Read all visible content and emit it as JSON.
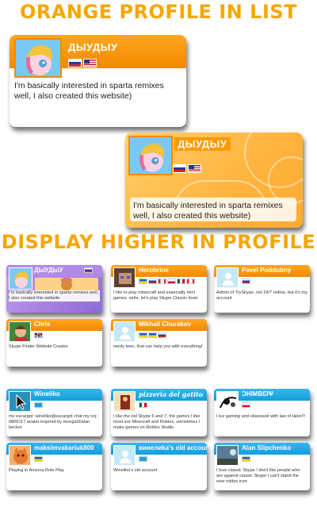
{
  "headings": {
    "top": "ORANGE PROFILE IN LIST",
    "middle": "DISPLAY HIGHER IN PROFILE"
  },
  "profile_card_list": {
    "name": "ДЫУДЫУ",
    "bio_line1": "I'm basically interested in sparta remixes",
    "bio_line2": "well, I also created this website)",
    "flags": [
      "ru",
      "us"
    ]
  },
  "profile_card_highlight": {
    "name": "ДЫУДЫУ",
    "bio_line1": "I'm basically interested in sparta remixes",
    "bio_line2": "well, I also created this website)",
    "flags": [
      "ru",
      "us"
    ]
  },
  "orange_cards": [
    {
      "name": "ДЫУДЫУ",
      "bio": "I'm basically interested in sparta remixes well, I also created this website"
    },
    {
      "name": "Herobrine",
      "bio": "I like to play minecraft and especially mini games. write, let's play Skype Classic lover"
    },
    {
      "name": "Pavel Poddubny",
      "bio": "Admin of TrySkype .not 24/7 online, but it's my account"
    },
    {
      "name": "Chris",
      "bio": "Skype Finder Website Creator"
    },
    {
      "name": "Mikhail Churakov",
      "bio": "nerdy teen, that can help you with everything!"
    }
  ],
  "blue_cards": [
    {
      "name": "Wineliko",
      "bio": "my escargot: wineliko@escargot chat my icq: 6806117 avatar inspired by moogal3/alan becker"
    },
    {
      "name": "pizzeria del gatito",
      "bio": "I like the old Skype 6 and 7, the games I like most are Minecraft and Roblox, sometimes I make games on Roblox Studio"
    },
    {
      "name": "ƆHIMBƐIΨ",
      "bio": "I luv gaming and obsessed with law of talos!!!"
    },
    {
      "name": "maksimvakariuk800",
      "bio": "Playing in Arizona Role Play"
    },
    {
      "name": "вииeлиka's old account",
      "bio": "Wineliko's old account"
    },
    {
      "name": "Alan Slipchenko",
      "bio": "I love classic Skype I don't like people who are against classic Skype I can't stand the new roblox icon"
    }
  ]
}
